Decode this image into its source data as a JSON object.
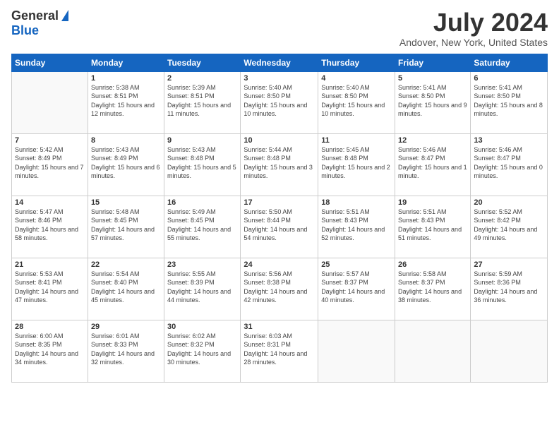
{
  "logo": {
    "general": "General",
    "blue": "Blue"
  },
  "header": {
    "title": "July 2024",
    "location": "Andover, New York, United States"
  },
  "days_of_week": [
    "Sunday",
    "Monday",
    "Tuesday",
    "Wednesday",
    "Thursday",
    "Friday",
    "Saturday"
  ],
  "weeks": [
    [
      {
        "day": "",
        "sunrise": "",
        "sunset": "",
        "daylight": ""
      },
      {
        "day": "1",
        "sunrise": "Sunrise: 5:38 AM",
        "sunset": "Sunset: 8:51 PM",
        "daylight": "Daylight: 15 hours and 12 minutes."
      },
      {
        "day": "2",
        "sunrise": "Sunrise: 5:39 AM",
        "sunset": "Sunset: 8:51 PM",
        "daylight": "Daylight: 15 hours and 11 minutes."
      },
      {
        "day": "3",
        "sunrise": "Sunrise: 5:40 AM",
        "sunset": "Sunset: 8:50 PM",
        "daylight": "Daylight: 15 hours and 10 minutes."
      },
      {
        "day": "4",
        "sunrise": "Sunrise: 5:40 AM",
        "sunset": "Sunset: 8:50 PM",
        "daylight": "Daylight: 15 hours and 10 minutes."
      },
      {
        "day": "5",
        "sunrise": "Sunrise: 5:41 AM",
        "sunset": "Sunset: 8:50 PM",
        "daylight": "Daylight: 15 hours and 9 minutes."
      },
      {
        "day": "6",
        "sunrise": "Sunrise: 5:41 AM",
        "sunset": "Sunset: 8:50 PM",
        "daylight": "Daylight: 15 hours and 8 minutes."
      }
    ],
    [
      {
        "day": "7",
        "sunrise": "Sunrise: 5:42 AM",
        "sunset": "Sunset: 8:49 PM",
        "daylight": "Daylight: 15 hours and 7 minutes."
      },
      {
        "day": "8",
        "sunrise": "Sunrise: 5:43 AM",
        "sunset": "Sunset: 8:49 PM",
        "daylight": "Daylight: 15 hours and 6 minutes."
      },
      {
        "day": "9",
        "sunrise": "Sunrise: 5:43 AM",
        "sunset": "Sunset: 8:48 PM",
        "daylight": "Daylight: 15 hours and 5 minutes."
      },
      {
        "day": "10",
        "sunrise": "Sunrise: 5:44 AM",
        "sunset": "Sunset: 8:48 PM",
        "daylight": "Daylight: 15 hours and 3 minutes."
      },
      {
        "day": "11",
        "sunrise": "Sunrise: 5:45 AM",
        "sunset": "Sunset: 8:48 PM",
        "daylight": "Daylight: 15 hours and 2 minutes."
      },
      {
        "day": "12",
        "sunrise": "Sunrise: 5:46 AM",
        "sunset": "Sunset: 8:47 PM",
        "daylight": "Daylight: 15 hours and 1 minute."
      },
      {
        "day": "13",
        "sunrise": "Sunrise: 5:46 AM",
        "sunset": "Sunset: 8:47 PM",
        "daylight": "Daylight: 15 hours and 0 minutes."
      }
    ],
    [
      {
        "day": "14",
        "sunrise": "Sunrise: 5:47 AM",
        "sunset": "Sunset: 8:46 PM",
        "daylight": "Daylight: 14 hours and 58 minutes."
      },
      {
        "day": "15",
        "sunrise": "Sunrise: 5:48 AM",
        "sunset": "Sunset: 8:45 PM",
        "daylight": "Daylight: 14 hours and 57 minutes."
      },
      {
        "day": "16",
        "sunrise": "Sunrise: 5:49 AM",
        "sunset": "Sunset: 8:45 PM",
        "daylight": "Daylight: 14 hours and 55 minutes."
      },
      {
        "day": "17",
        "sunrise": "Sunrise: 5:50 AM",
        "sunset": "Sunset: 8:44 PM",
        "daylight": "Daylight: 14 hours and 54 minutes."
      },
      {
        "day": "18",
        "sunrise": "Sunrise: 5:51 AM",
        "sunset": "Sunset: 8:43 PM",
        "daylight": "Daylight: 14 hours and 52 minutes."
      },
      {
        "day": "19",
        "sunrise": "Sunrise: 5:51 AM",
        "sunset": "Sunset: 8:43 PM",
        "daylight": "Daylight: 14 hours and 51 minutes."
      },
      {
        "day": "20",
        "sunrise": "Sunrise: 5:52 AM",
        "sunset": "Sunset: 8:42 PM",
        "daylight": "Daylight: 14 hours and 49 minutes."
      }
    ],
    [
      {
        "day": "21",
        "sunrise": "Sunrise: 5:53 AM",
        "sunset": "Sunset: 8:41 PM",
        "daylight": "Daylight: 14 hours and 47 minutes."
      },
      {
        "day": "22",
        "sunrise": "Sunrise: 5:54 AM",
        "sunset": "Sunset: 8:40 PM",
        "daylight": "Daylight: 14 hours and 45 minutes."
      },
      {
        "day": "23",
        "sunrise": "Sunrise: 5:55 AM",
        "sunset": "Sunset: 8:39 PM",
        "daylight": "Daylight: 14 hours and 44 minutes."
      },
      {
        "day": "24",
        "sunrise": "Sunrise: 5:56 AM",
        "sunset": "Sunset: 8:38 PM",
        "daylight": "Daylight: 14 hours and 42 minutes."
      },
      {
        "day": "25",
        "sunrise": "Sunrise: 5:57 AM",
        "sunset": "Sunset: 8:37 PM",
        "daylight": "Daylight: 14 hours and 40 minutes."
      },
      {
        "day": "26",
        "sunrise": "Sunrise: 5:58 AM",
        "sunset": "Sunset: 8:37 PM",
        "daylight": "Daylight: 14 hours and 38 minutes."
      },
      {
        "day": "27",
        "sunrise": "Sunrise: 5:59 AM",
        "sunset": "Sunset: 8:36 PM",
        "daylight": "Daylight: 14 hours and 36 minutes."
      }
    ],
    [
      {
        "day": "28",
        "sunrise": "Sunrise: 6:00 AM",
        "sunset": "Sunset: 8:35 PM",
        "daylight": "Daylight: 14 hours and 34 minutes."
      },
      {
        "day": "29",
        "sunrise": "Sunrise: 6:01 AM",
        "sunset": "Sunset: 8:33 PM",
        "daylight": "Daylight: 14 hours and 32 minutes."
      },
      {
        "day": "30",
        "sunrise": "Sunrise: 6:02 AM",
        "sunset": "Sunset: 8:32 PM",
        "daylight": "Daylight: 14 hours and 30 minutes."
      },
      {
        "day": "31",
        "sunrise": "Sunrise: 6:03 AM",
        "sunset": "Sunset: 8:31 PM",
        "daylight": "Daylight: 14 hours and 28 minutes."
      },
      {
        "day": "",
        "sunrise": "",
        "sunset": "",
        "daylight": ""
      },
      {
        "day": "",
        "sunrise": "",
        "sunset": "",
        "daylight": ""
      },
      {
        "day": "",
        "sunrise": "",
        "sunset": "",
        "daylight": ""
      }
    ]
  ]
}
